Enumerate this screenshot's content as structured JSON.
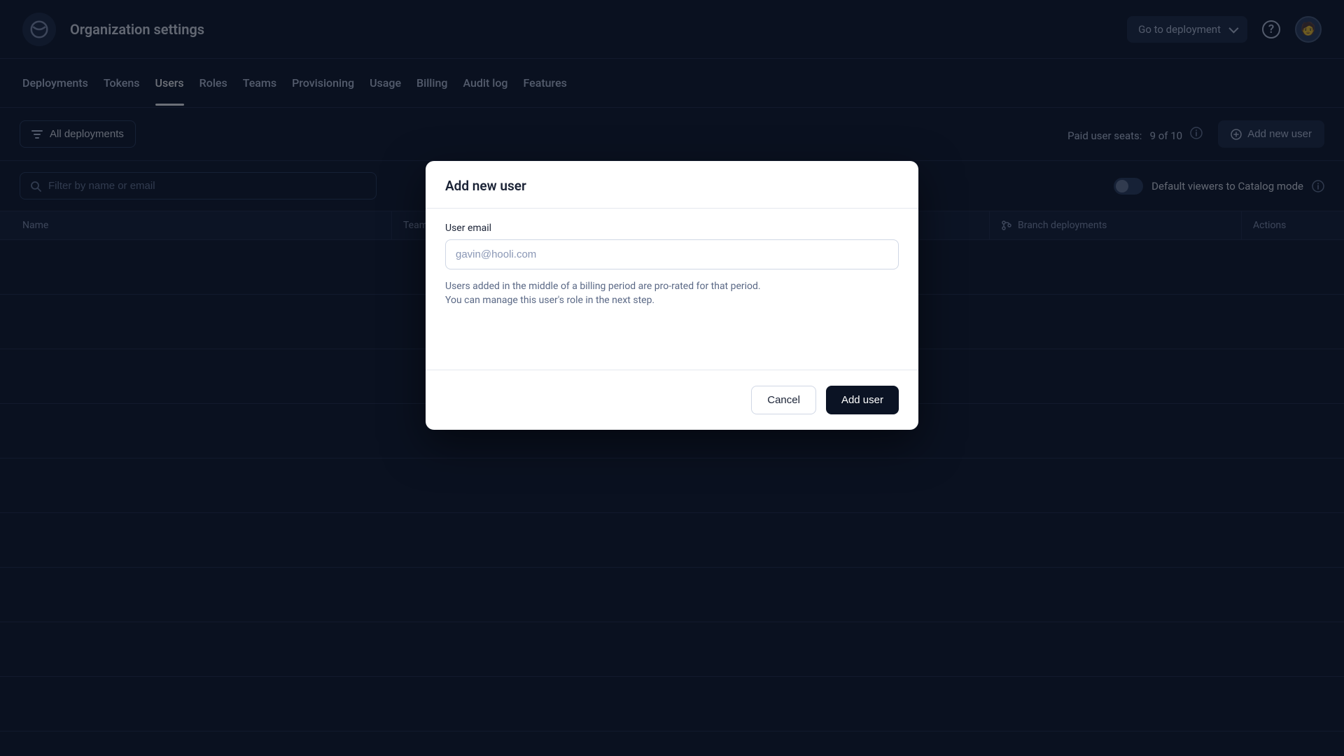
{
  "header": {
    "title": "Organization settings",
    "deployment_select_label": "Go to deployment",
    "help_icon_label": "?",
    "avatar_emoji": "🧑"
  },
  "tabs": [
    {
      "label": "Deployments",
      "active": false
    },
    {
      "label": "Tokens",
      "active": false
    },
    {
      "label": "Users",
      "active": true
    },
    {
      "label": "Roles",
      "active": false
    },
    {
      "label": "Teams",
      "active": false
    },
    {
      "label": "Provisioning",
      "active": false
    },
    {
      "label": "Usage",
      "active": false
    },
    {
      "label": "Billing",
      "active": false
    },
    {
      "label": "Audit log",
      "active": false
    },
    {
      "label": "Features",
      "active": false
    }
  ],
  "toolbar": {
    "filter_label": "All deployments",
    "seats_label": "Paid user seats:",
    "seats_value": "9 of 10",
    "add_user_button": "Add new user"
  },
  "search": {
    "placeholder": "Filter by name or email",
    "value": "",
    "toggle_label": "Default viewers to Catalog mode"
  },
  "table": {
    "columns": {
      "name": "Name",
      "team": "Team",
      "role": "",
      "branch": "Branch deployments",
      "actions": "Actions"
    }
  },
  "modal": {
    "title": "Add new user",
    "field_label": "User email",
    "input_placeholder": "gavin@hooli.com",
    "input_value": "",
    "help_text_line1": "Users added in the middle of a billing period are pro-rated for that period.",
    "help_text_line2": "You can manage this user's role in the next step.",
    "cancel_label": "Cancel",
    "submit_label": "Add user"
  }
}
